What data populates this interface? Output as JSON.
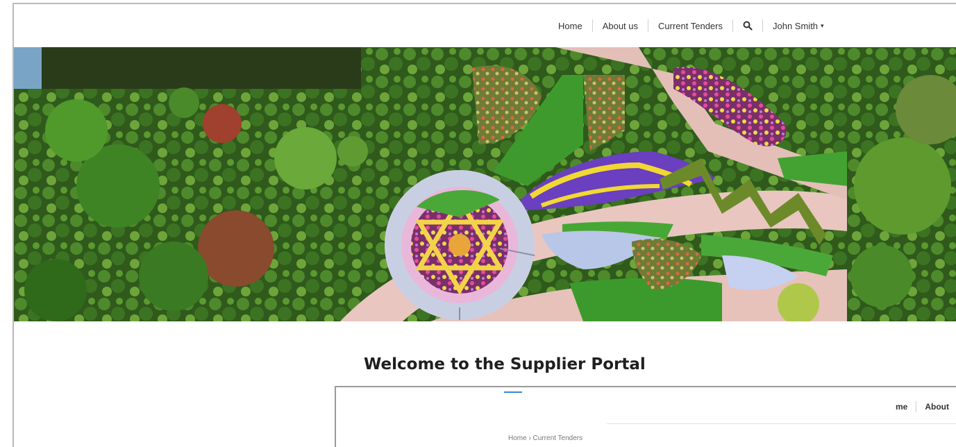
{
  "nav": {
    "home": "Home",
    "about": "About us",
    "tenders": "Current Tenders",
    "user": "John Smith",
    "search_icon": "search-icon"
  },
  "welcome": "Welcome to the Supplier Portal",
  "inner": {
    "nav_home": "me",
    "nav_about": "About",
    "breadcrumb": "Home  ›  Current Tenders"
  },
  "colors": {
    "border": "#b9b9b9",
    "accent": "#3a86d8",
    "text": "#1f1f1f"
  }
}
